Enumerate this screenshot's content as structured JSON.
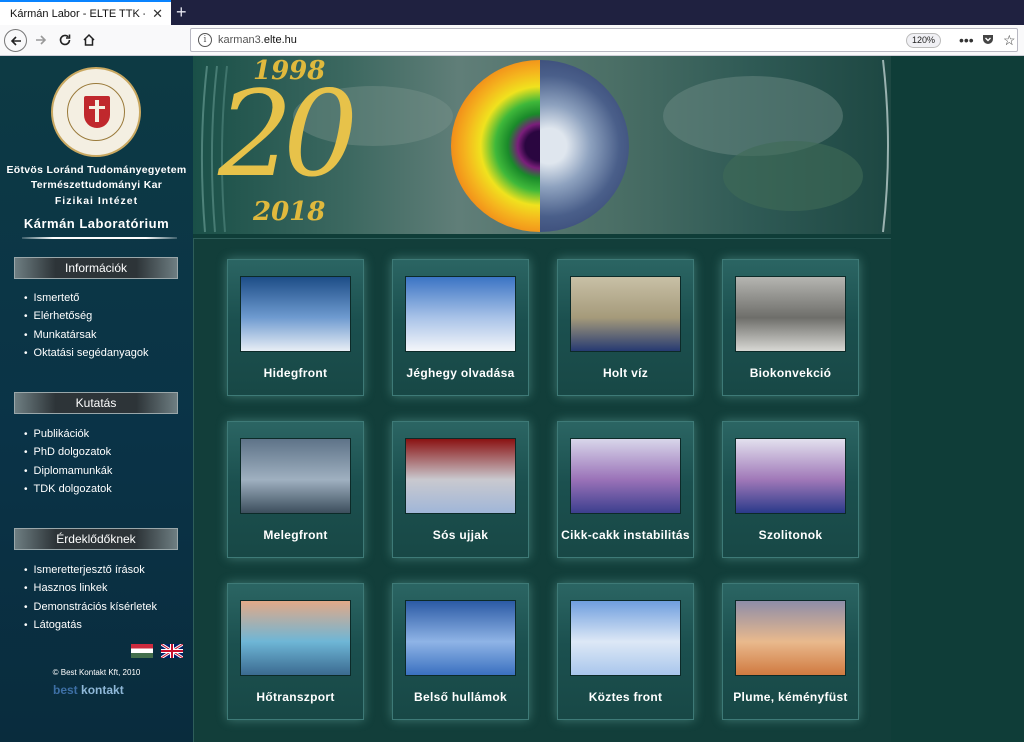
{
  "browser": {
    "tab_title": "Kármán Labor - ELTE TTK - Fizikai Intézet",
    "new_tab": "+",
    "close": "✕",
    "url_host": "karman3.",
    "url_domain": "elte.hu",
    "zoom": "120%"
  },
  "sidebar": {
    "university_line1": "Eötvös Loránd Tudományegyetem",
    "university_line2": "Természettudományi Kar",
    "university_line3": "Fizikai Intézet",
    "lab_name": "Kármán Laboratórium",
    "sections": [
      {
        "title": "Információk",
        "items": [
          "Ismertető",
          "Elérhetőség",
          "Munkatársak",
          "Oktatási segédanyagok"
        ]
      },
      {
        "title": "Kutatás",
        "items": [
          "Publikációk",
          "PhD dolgozatok",
          "Diplomamunkák",
          "TDK dolgozatok"
        ]
      },
      {
        "title": "Érdeklődőknek",
        "items": [
          "Ismeretterjesztő írások",
          "Hasznos linkek",
          "Demonstrációs kísérletek",
          "Látogatás"
        ]
      }
    ],
    "copyright": "© Best Kontakt Kft, 2010",
    "logo_best": "best",
    "logo_kontakt": "kontakt"
  },
  "banner": {
    "year_start": "1998",
    "year_end": "2018",
    "anniversary": "20"
  },
  "tiles": [
    {
      "label": "Hidegfront",
      "colors": [
        "#1d4d87",
        "#6f9bd0",
        "#e8eef5"
      ]
    },
    {
      "label": "Jéghegy olvadása",
      "colors": [
        "#3b74c4",
        "#a9c3e8",
        "#f4f6fa"
      ]
    },
    {
      "label": "Holt víz",
      "colors": [
        "#c8c0a6",
        "#a59a7a",
        "#263a72"
      ]
    },
    {
      "label": "Biokonvekció",
      "colors": [
        "#b5b5b1",
        "#6e6e6a",
        "#d8d8d4"
      ]
    },
    {
      "label": "Melegfront",
      "colors": [
        "#5e7388",
        "#9fb0c0",
        "#3c4e5c"
      ]
    },
    {
      "label": "Sós ujjak",
      "colors": [
        "#8a1212",
        "#c9c9cf",
        "#a0b6d8"
      ]
    },
    {
      "label": "Cikk-cakk instabilitás",
      "colors": [
        "#d8d6ea",
        "#9a72b8",
        "#3c3f8e"
      ]
    },
    {
      "label": "Szolitonok",
      "colors": [
        "#e2e0ee",
        "#a078b8",
        "#2a3a8a"
      ]
    },
    {
      "label": "Hőtranszport",
      "colors": [
        "#e2a988",
        "#6eb6d6",
        "#3b6a90"
      ]
    },
    {
      "label": "Belső hullámok",
      "colors": [
        "#2b5aa5",
        "#8fb4e6",
        "#3a70c0"
      ]
    },
    {
      "label": "Köztes front",
      "colors": [
        "#6f9ede",
        "#dde8f6",
        "#a9c6ec"
      ]
    },
    {
      "label": "Plume, kéményfüst",
      "colors": [
        "#8e8da8",
        "#e9b98d",
        "#d07a40"
      ]
    }
  ]
}
